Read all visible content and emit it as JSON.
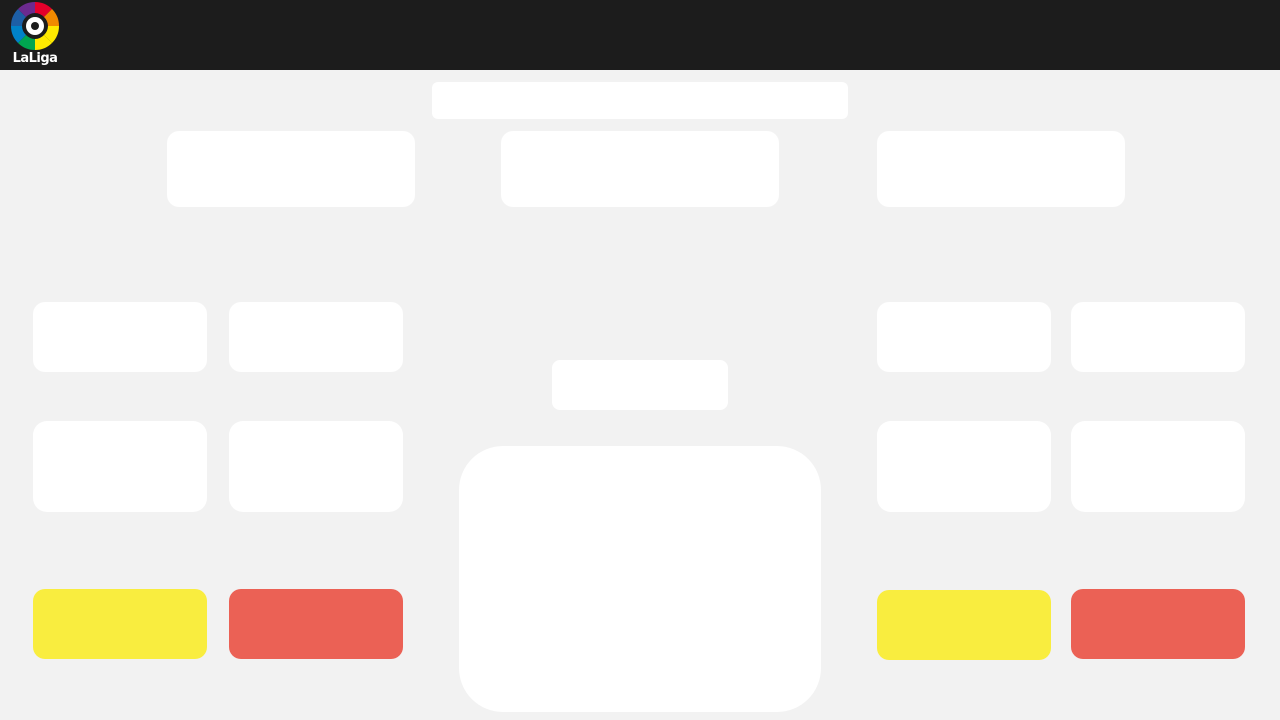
{
  "header": {
    "logo_text": "LaLiga",
    "logo_colors": [
      "#1b1b1b",
      "#e4002b",
      "#f18a00",
      "#ffe900",
      "#00a650",
      "#0082c8",
      "#6c2a8f",
      "#c8102e"
    ]
  },
  "colors": {
    "page_background": "#f2f2f2",
    "topbar": "#1c1c1c",
    "panel": "#ffffff",
    "yellow_card": "#f9ed3f",
    "red_card": "#eb6155"
  },
  "panels": {
    "title": "",
    "team_home": "",
    "score": "",
    "team_away": ""
  }
}
